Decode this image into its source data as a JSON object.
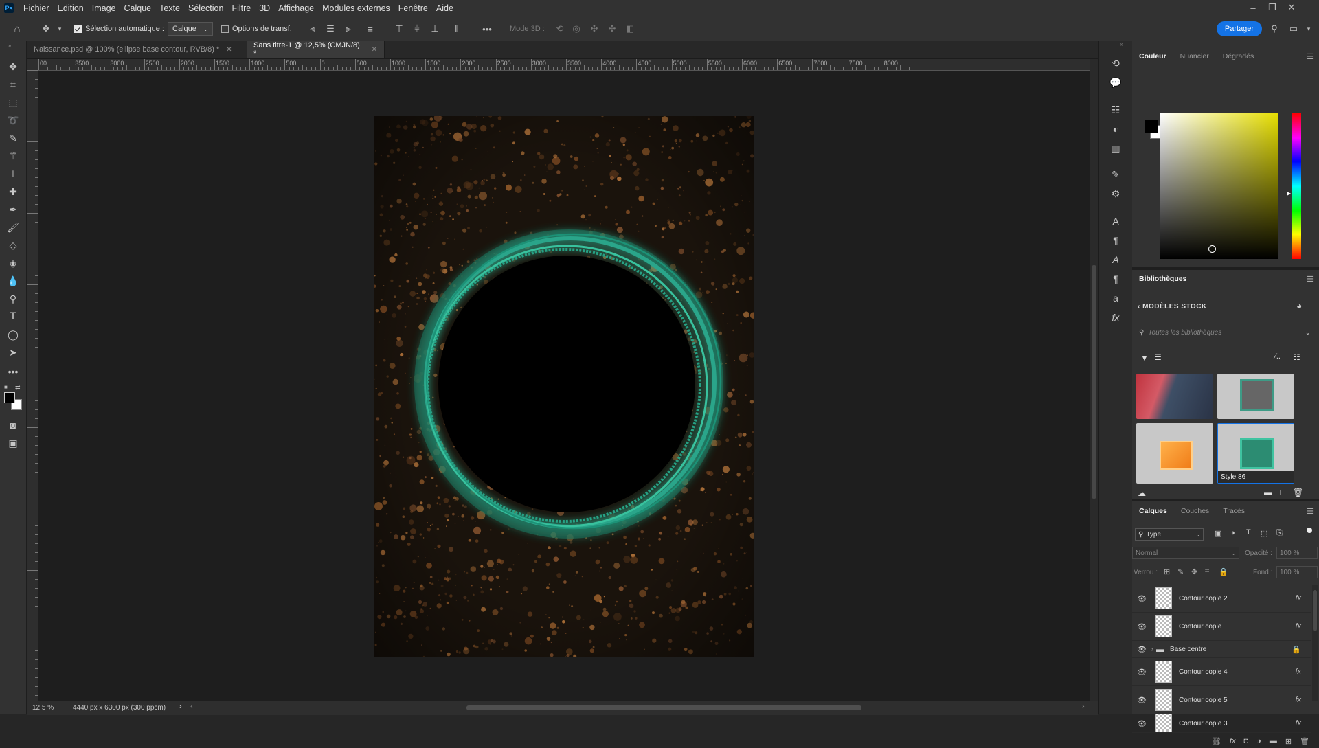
{
  "app": {
    "logo": "Ps"
  },
  "menu": [
    "Fichier",
    "Edition",
    "Image",
    "Calque",
    "Texte",
    "Sélection",
    "Filtre",
    "3D",
    "Affichage",
    "Modules externes",
    "Fenêtre",
    "Aide"
  ],
  "options": {
    "auto_select_label": "Sélection automatique :",
    "auto_select_value": "Calque",
    "transform_label": "Options de transf.",
    "mode3d_label": "Mode 3D :",
    "share_label": "Partager"
  },
  "tabs": [
    {
      "label": "Naissance.psd @ 100% (ellipse base contour, RVB/8) *",
      "active": false
    },
    {
      "label": "Sans titre-1 @ 12,5% (CMJN/8) *",
      "active": true
    }
  ],
  "ruler_labels": [
    "00",
    "3500",
    "3000",
    "2500",
    "2000",
    "1500",
    "1000",
    "500",
    "0",
    "500",
    "1000",
    "1500",
    "2000",
    "2500",
    "3000",
    "3500",
    "4000",
    "4500",
    "5000",
    "5500",
    "6000",
    "6500",
    "7000",
    "7500",
    "8000"
  ],
  "status": {
    "zoom": "12,5 %",
    "doc_info": "4440 px x 6300 px (300 ppcm)"
  },
  "color_panel": {
    "tabs": [
      "Couleur",
      "Nuancier",
      "Dégradés"
    ],
    "foreground": "#000000",
    "background": "#ffffff",
    "hue_color": "#e6de00"
  },
  "libraries": {
    "title": "Bibliothèques",
    "back_label": "MODÈLES STOCK",
    "search_placeholder": "Toutes les bibliothèques",
    "selected_item_label": "Style 86"
  },
  "layers_panel": {
    "tabs": [
      "Calques",
      "Couches",
      "Tracés"
    ],
    "filter_label": "Type",
    "blend_mode": "Normal",
    "opacity_label": "Opacité :",
    "opacity_value": "100 %",
    "lock_label": "Verrou :",
    "fill_label": "Fond :",
    "fill_value": "100 %",
    "layers": [
      {
        "name": "Contour copie 2",
        "type": "layer",
        "fx": "fx"
      },
      {
        "name": "Contour copie",
        "type": "layer",
        "fx": "fx"
      },
      {
        "name": "Base centre",
        "type": "group",
        "fx": ""
      },
      {
        "name": "Contour copie 4",
        "type": "layer",
        "fx": "fx"
      },
      {
        "name": "Contour copie 5",
        "type": "layer",
        "fx": "fx"
      },
      {
        "name": "Contour copie 3",
        "type": "layer",
        "fx": "fx"
      }
    ]
  },
  "colors": {
    "accent": "#1473e6",
    "ring": "#2aa58a",
    "dust": "#9a5f2c"
  }
}
